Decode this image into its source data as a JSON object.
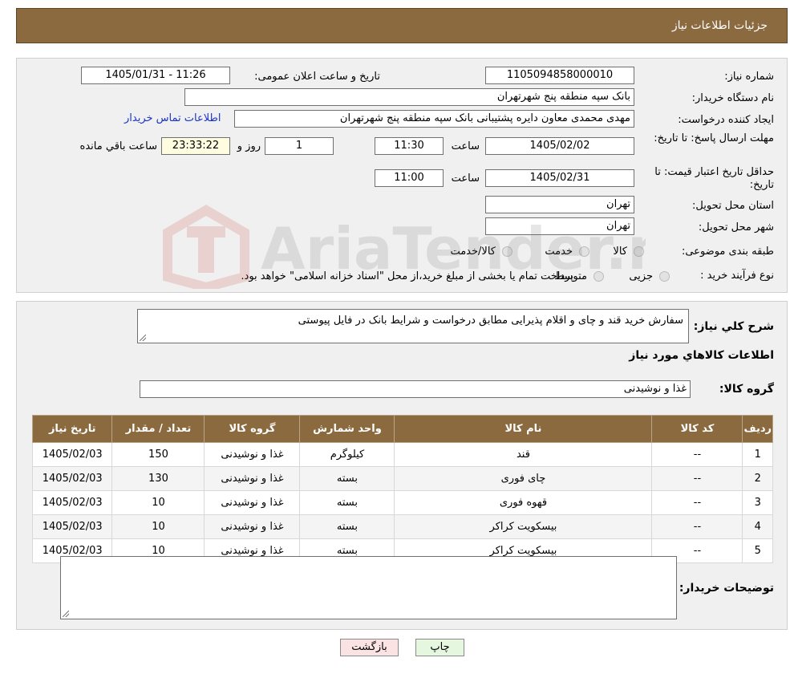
{
  "header": {
    "title": "جزئیات اطلاعات نیاز"
  },
  "form": {
    "need_number_label": "شماره نیاز:",
    "need_number": "1105094858000010",
    "announce_label": "تاریخ و ساعت اعلان عمومی:",
    "announce_value": "1405/01/31 - 11:26",
    "buyer_org_label": "نام دستگاه خریدار:",
    "buyer_org": "بانک سپه منطقه پنج شهرتهران",
    "creator_label": "ایجاد کننده درخواست:",
    "creator": "مهدی محمدی معاون دایره پشتیبانی بانک سپه منطقه پنج شهرتهران",
    "contact_link": "اطلاعات تماس خریدار",
    "deadline_label": "مهلت ارسال پاسخ: تا تاریخ:",
    "deadline_date": "1405/02/02",
    "time_label": "ساعت",
    "deadline_time": "11:30",
    "days_value": "1",
    "days_label": "روز و",
    "remaining_time": "23:33:22",
    "remaining_label": "ساعت باقي مانده",
    "validity_label": "حداقل تاریخ اعتبار قیمت: تا تاریخ:",
    "validity_date": "1405/02/31",
    "validity_time": "11:00",
    "province_label": "استان محل تحویل:",
    "province": "تهران",
    "city_label": "شهر محل تحویل:",
    "city": "تهران",
    "category_label": "طبقه بندی موضوعی:",
    "category_options": [
      "کالا",
      "خدمت",
      "کالا/خدمت"
    ],
    "process_label": "نوع فرآیند خرید :",
    "process_options": [
      "جزیی",
      "متوسط"
    ],
    "process_note": "پرداخت تمام یا بخشی از مبلغ خرید،از محل \"اسناد خزانه اسلامی\" خواهد بود."
  },
  "details": {
    "summary_label": "شرح کلي نياز:",
    "summary": "سفارش خرید قند و چای و اقلام پذیرایی مطابق درخواست و شرایط بانک در فایل پیوستی",
    "items_title": "اطلاعات کالاهاي مورد نياز",
    "group_label": "گروه کالا:",
    "group": "غذا و نوشیدنی",
    "table": {
      "headers": [
        "ردیف",
        "کد کالا",
        "نام کالا",
        "واحد شمارش",
        "گروه کالا",
        "تعداد / مقدار",
        "تاریخ نیاز"
      ],
      "rows": [
        [
          "1",
          "--",
          "قند",
          "کیلوگرم",
          "غذا و نوشیدنی",
          "150",
          "1405/02/03"
        ],
        [
          "2",
          "--",
          "چای فوری",
          "بسته",
          "غذا و نوشیدنی",
          "130",
          "1405/02/03"
        ],
        [
          "3",
          "--",
          "قهوه فوری",
          "بسته",
          "غذا و نوشیدنی",
          "10",
          "1405/02/03"
        ],
        [
          "4",
          "--",
          "بیسکویت کراکر",
          "بسته",
          "غذا و نوشیدنی",
          "10",
          "1405/02/03"
        ],
        [
          "5",
          "--",
          "بیسکویت کراکر",
          "بسته",
          "غذا و نوشیدنی",
          "10",
          "1405/02/03"
        ]
      ]
    },
    "buyer_notes_label": "توضیحات خریدار:",
    "buyer_notes": ""
  },
  "buttons": {
    "print": "چاپ",
    "back": "بازگشت"
  },
  "watermark": {
    "text": "AriaTender.neT"
  },
  "colors": {
    "header_bg": "#8c6a3f",
    "link": "#1a33c8",
    "print_btn": "#e6f7e0",
    "back_btn": "#fbe3e3"
  }
}
